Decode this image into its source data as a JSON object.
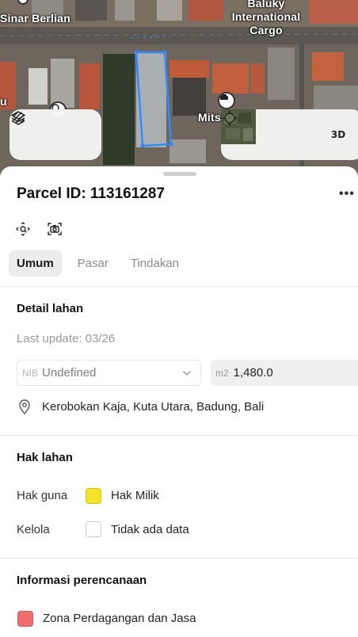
{
  "map": {
    "labels": {
      "sinar": "Sinar Berlian",
      "cargo_line1": "Baluky",
      "cargo_line2": "International",
      "cargo_line3": "Cargo",
      "mits": "Mits",
      "u": "u"
    },
    "controls": {
      "layers_icon": "layers-icon",
      "draw_icon": "draw-icon",
      "locate_icon": "crosshair-icon",
      "three_d_label": "3D"
    },
    "parcel_outline_color": "#2f8bff"
  },
  "parcel": {
    "title": "Parcel ID: 113161287",
    "more_label": "•••"
  },
  "tabs": [
    {
      "label": "Umum",
      "active": true
    },
    {
      "label": "Pasar",
      "active": false
    },
    {
      "label": "Tindakan",
      "active": false
    }
  ],
  "detail": {
    "title": "Detail lahan",
    "last_update": "Last update: 03/26",
    "nib_prefix": "NIB",
    "nib_value": "Undefined",
    "area_prefix": "m2",
    "area_value": "1,480.0",
    "address": "Kerobokan Kaja, Kuta Utara, Badung, Bali"
  },
  "hak": {
    "title": "Hak lahan",
    "hak_guna_label": "Hak guna",
    "hak_guna_value": "Hak Milik",
    "hak_guna_color": "#f7e22b",
    "kelola_label": "Kelola",
    "kelola_value": "Tidak ada data"
  },
  "planning": {
    "title": "Informasi perencanaan",
    "zone_label": "Zona Perdagangan dan Jasa",
    "zone_color": "#f06b6b"
  }
}
